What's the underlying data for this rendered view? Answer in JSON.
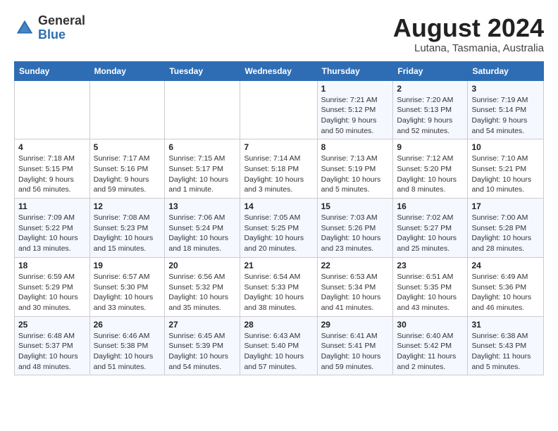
{
  "header": {
    "logo_general": "General",
    "logo_blue": "Blue",
    "month_year": "August 2024",
    "location": "Lutana, Tasmania, Australia"
  },
  "weekdays": [
    "Sunday",
    "Monday",
    "Tuesday",
    "Wednesday",
    "Thursday",
    "Friday",
    "Saturday"
  ],
  "weeks": [
    [
      {
        "day": "",
        "info": ""
      },
      {
        "day": "",
        "info": ""
      },
      {
        "day": "",
        "info": ""
      },
      {
        "day": "",
        "info": ""
      },
      {
        "day": "1",
        "info": "Sunrise: 7:21 AM\nSunset: 5:12 PM\nDaylight: 9 hours\nand 50 minutes."
      },
      {
        "day": "2",
        "info": "Sunrise: 7:20 AM\nSunset: 5:13 PM\nDaylight: 9 hours\nand 52 minutes."
      },
      {
        "day": "3",
        "info": "Sunrise: 7:19 AM\nSunset: 5:14 PM\nDaylight: 9 hours\nand 54 minutes."
      }
    ],
    [
      {
        "day": "4",
        "info": "Sunrise: 7:18 AM\nSunset: 5:15 PM\nDaylight: 9 hours\nand 56 minutes."
      },
      {
        "day": "5",
        "info": "Sunrise: 7:17 AM\nSunset: 5:16 PM\nDaylight: 9 hours\nand 59 minutes."
      },
      {
        "day": "6",
        "info": "Sunrise: 7:15 AM\nSunset: 5:17 PM\nDaylight: 10 hours\nand 1 minute."
      },
      {
        "day": "7",
        "info": "Sunrise: 7:14 AM\nSunset: 5:18 PM\nDaylight: 10 hours\nand 3 minutes."
      },
      {
        "day": "8",
        "info": "Sunrise: 7:13 AM\nSunset: 5:19 PM\nDaylight: 10 hours\nand 5 minutes."
      },
      {
        "day": "9",
        "info": "Sunrise: 7:12 AM\nSunset: 5:20 PM\nDaylight: 10 hours\nand 8 minutes."
      },
      {
        "day": "10",
        "info": "Sunrise: 7:10 AM\nSunset: 5:21 PM\nDaylight: 10 hours\nand 10 minutes."
      }
    ],
    [
      {
        "day": "11",
        "info": "Sunrise: 7:09 AM\nSunset: 5:22 PM\nDaylight: 10 hours\nand 13 minutes."
      },
      {
        "day": "12",
        "info": "Sunrise: 7:08 AM\nSunset: 5:23 PM\nDaylight: 10 hours\nand 15 minutes."
      },
      {
        "day": "13",
        "info": "Sunrise: 7:06 AM\nSunset: 5:24 PM\nDaylight: 10 hours\nand 18 minutes."
      },
      {
        "day": "14",
        "info": "Sunrise: 7:05 AM\nSunset: 5:25 PM\nDaylight: 10 hours\nand 20 minutes."
      },
      {
        "day": "15",
        "info": "Sunrise: 7:03 AM\nSunset: 5:26 PM\nDaylight: 10 hours\nand 23 minutes."
      },
      {
        "day": "16",
        "info": "Sunrise: 7:02 AM\nSunset: 5:27 PM\nDaylight: 10 hours\nand 25 minutes."
      },
      {
        "day": "17",
        "info": "Sunrise: 7:00 AM\nSunset: 5:28 PM\nDaylight: 10 hours\nand 28 minutes."
      }
    ],
    [
      {
        "day": "18",
        "info": "Sunrise: 6:59 AM\nSunset: 5:29 PM\nDaylight: 10 hours\nand 30 minutes."
      },
      {
        "day": "19",
        "info": "Sunrise: 6:57 AM\nSunset: 5:30 PM\nDaylight: 10 hours\nand 33 minutes."
      },
      {
        "day": "20",
        "info": "Sunrise: 6:56 AM\nSunset: 5:32 PM\nDaylight: 10 hours\nand 35 minutes."
      },
      {
        "day": "21",
        "info": "Sunrise: 6:54 AM\nSunset: 5:33 PM\nDaylight: 10 hours\nand 38 minutes."
      },
      {
        "day": "22",
        "info": "Sunrise: 6:53 AM\nSunset: 5:34 PM\nDaylight: 10 hours\nand 41 minutes."
      },
      {
        "day": "23",
        "info": "Sunrise: 6:51 AM\nSunset: 5:35 PM\nDaylight: 10 hours\nand 43 minutes."
      },
      {
        "day": "24",
        "info": "Sunrise: 6:49 AM\nSunset: 5:36 PM\nDaylight: 10 hours\nand 46 minutes."
      }
    ],
    [
      {
        "day": "25",
        "info": "Sunrise: 6:48 AM\nSunset: 5:37 PM\nDaylight: 10 hours\nand 48 minutes."
      },
      {
        "day": "26",
        "info": "Sunrise: 6:46 AM\nSunset: 5:38 PM\nDaylight: 10 hours\nand 51 minutes."
      },
      {
        "day": "27",
        "info": "Sunrise: 6:45 AM\nSunset: 5:39 PM\nDaylight: 10 hours\nand 54 minutes."
      },
      {
        "day": "28",
        "info": "Sunrise: 6:43 AM\nSunset: 5:40 PM\nDaylight: 10 hours\nand 57 minutes."
      },
      {
        "day": "29",
        "info": "Sunrise: 6:41 AM\nSunset: 5:41 PM\nDaylight: 10 hours\nand 59 minutes."
      },
      {
        "day": "30",
        "info": "Sunrise: 6:40 AM\nSunset: 5:42 PM\nDaylight: 11 hours\nand 2 minutes."
      },
      {
        "day": "31",
        "info": "Sunrise: 6:38 AM\nSunset: 5:43 PM\nDaylight: 11 hours\nand 5 minutes."
      }
    ]
  ]
}
